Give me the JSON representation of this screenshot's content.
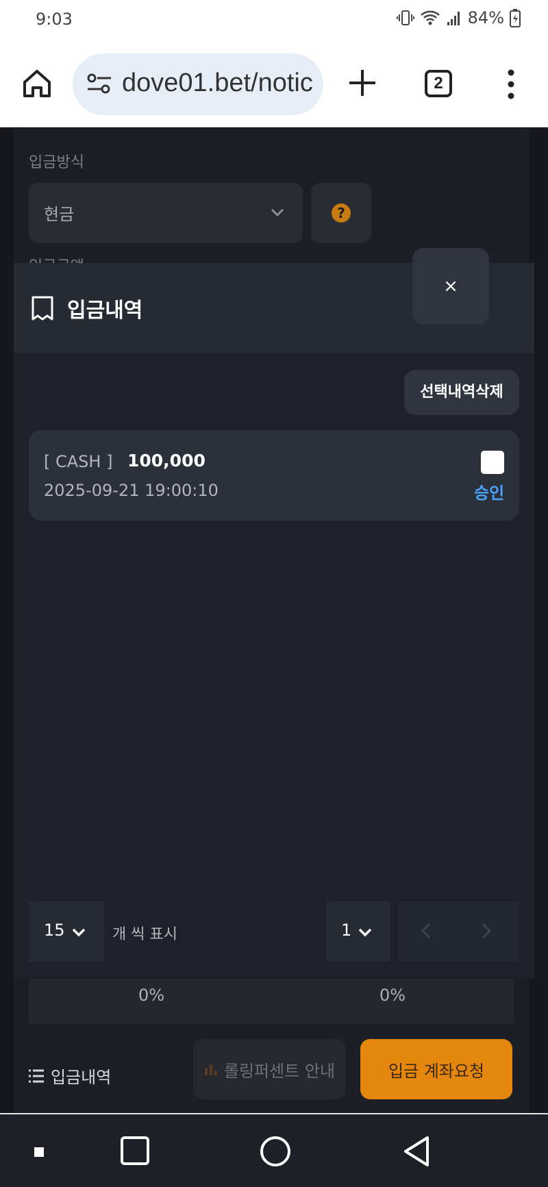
{
  "status_bar": {
    "time": "9:03",
    "battery": "84%"
  },
  "browser": {
    "url": "dove01.bet/notic",
    "tab_count": "2"
  },
  "background_page": {
    "method_label": "입금방식",
    "method_value": "현금",
    "amount_label_cut": "입금금액",
    "percent_left": "0%",
    "percent_right": "0%",
    "history_link": "입금내역",
    "rolling_button": "롤링퍼센트 안내",
    "request_button": "입금 계좌요청"
  },
  "modal": {
    "title": "입금내역",
    "close_label": "×",
    "delete_button": "선택내역삭제",
    "items": [
      {
        "type": "[ CASH ]",
        "amount": "100,000",
        "date": "2025-09-21 19:00:10",
        "status": "승인"
      }
    ],
    "pager": {
      "per_page": "15",
      "per_page_label": "개 씩 표시",
      "page": "1"
    }
  },
  "colors": {
    "accent_orange": "#e5860f",
    "status_blue": "#4aa3ff",
    "modal_bg": "#1e2129"
  }
}
